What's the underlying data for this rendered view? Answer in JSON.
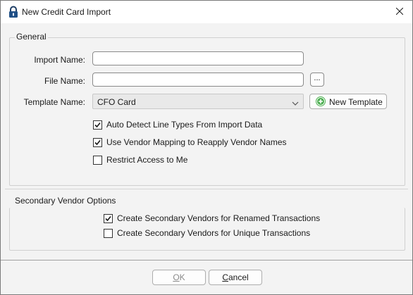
{
  "window": {
    "title": "New Credit Card Import",
    "icons": {
      "app": "lock-icon",
      "close": "close-icon"
    }
  },
  "general": {
    "group_title": "General",
    "import_name": {
      "label": "Import Name:",
      "value": ""
    },
    "file_name": {
      "label": "File Name:",
      "value": "",
      "browse_label": "..."
    },
    "template_name": {
      "label": "Template Name:",
      "selected": "CFO Card",
      "new_template_label": "New Template"
    },
    "checkboxes": [
      {
        "label": "Auto Detect Line Types From Import Data",
        "checked": true
      },
      {
        "label": "Use Vendor Mapping to Reapply Vendor Names",
        "checked": true
      },
      {
        "label": "Restrict Access to Me",
        "checked": false
      }
    ]
  },
  "secondary": {
    "group_title": "Secondary Vendor Options",
    "checkboxes": [
      {
        "label": "Create Secondary Vendors for Renamed Transactions",
        "checked": true
      },
      {
        "label": "Create Secondary Vendors for Unique Transactions",
        "checked": false
      }
    ]
  },
  "footer": {
    "ok_first": "O",
    "ok_rest": "K",
    "cancel_first": "C",
    "cancel_rest": "ancel"
  },
  "colors": {
    "accent_green": "#4caf50"
  }
}
